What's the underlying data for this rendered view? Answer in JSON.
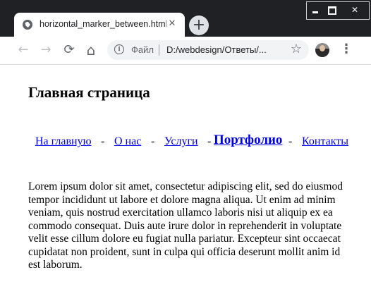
{
  "browser": {
    "tab_title": "horizontal_marker_between.html",
    "tab_close": "✕",
    "new_tab": "+",
    "window_controls": {
      "minimize": "",
      "maximize": "",
      "close": "✕"
    },
    "toolbar": {
      "back": "←",
      "forward": "→",
      "reload": "⟳",
      "home": "⌂",
      "omnibox_label": "Файл",
      "url": "D:/webdesign/Ответы/...",
      "star": "☆",
      "menu": "⋮"
    }
  },
  "page": {
    "title": "Главная страница",
    "nav": {
      "items": [
        "На главную",
        "О нас",
        "Услуги",
        "Портфолио",
        "Контакты"
      ],
      "separator": "-"
    },
    "paragraph": "Lorem ipsum dolor sit amet, consectetur adipiscing elit, sed do eiusmod tempor incididunt ut labore et dolore magna aliqua. Ut enim ad minim veniam, quis nostrud exercitation ullamco laboris nisi ut aliquip ex ea commodo consequat. Duis aute irure dolor in reprehenderit in voluptate velit esse cillum dolore eu fugiat nulla pariatur. Excepteur sint occaecat cupidatat non proident, sunt in culpa qui officia deserunt mollit anim id est laborum."
  }
}
